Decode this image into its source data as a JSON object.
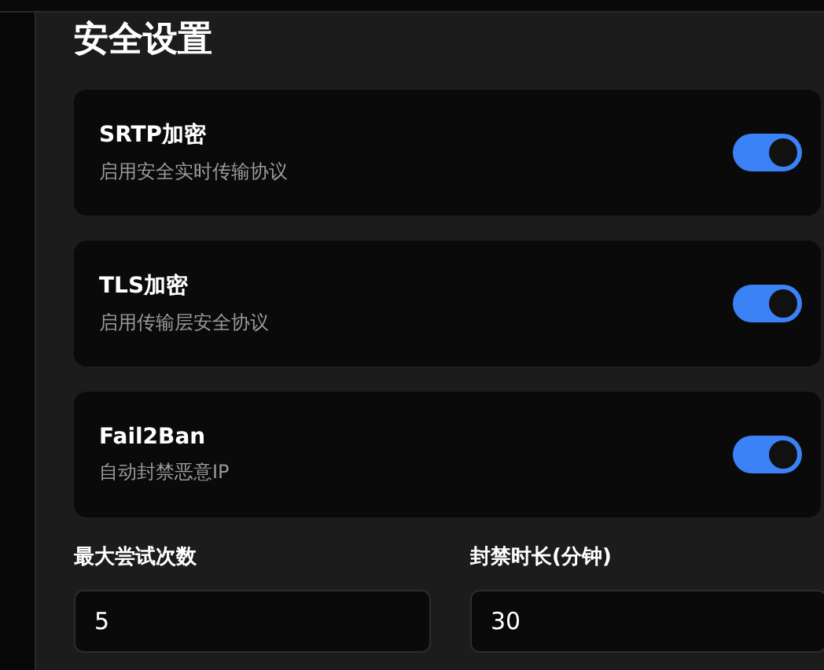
{
  "section_title": "安全设置",
  "settings": [
    {
      "title": "SRTP加密",
      "description": "启用安全实时传输协议",
      "on": true
    },
    {
      "title": "TLS加密",
      "description": "启用传输层安全协议",
      "on": true
    },
    {
      "title": "Fail2Ban",
      "description": "自动封禁恶意IP",
      "on": true
    }
  ],
  "fields": [
    {
      "label": "最大尝试次数",
      "value": "5"
    },
    {
      "label": "封禁时长(分钟)",
      "value": "30"
    }
  ]
}
